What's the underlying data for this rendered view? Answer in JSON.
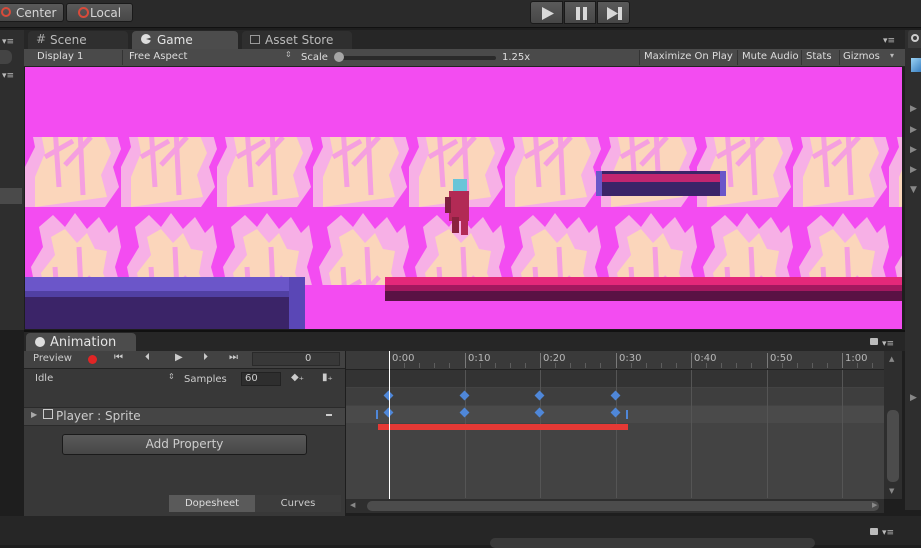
{
  "toolbar": {
    "pivot_label": "Center",
    "space_label": "Local",
    "play_icon": "play-icon",
    "pause_icon": "pause-icon",
    "step_icon": "step-icon"
  },
  "tabs": [
    {
      "label": "Scene",
      "icon": "grid-icon"
    },
    {
      "label": "Game",
      "icon": "pacman-icon"
    },
    {
      "label": "Asset Store",
      "icon": "store-icon"
    }
  ],
  "game_bar": {
    "display": "Display 1",
    "aspect": "Free Aspect",
    "scale_label": "Scale",
    "scale_value": "1.25x",
    "maximize": "Maximize On Play",
    "mute": "Mute Audio",
    "stats": "Stats",
    "gizmos": "Gizmos"
  },
  "animation": {
    "tab_label": "Animation",
    "preview_label": "Preview",
    "frame_value": "0",
    "clip_name": "Idle",
    "samples_label": "Samples",
    "samples_value": "60",
    "property_label": "Player : Sprite",
    "add_property": "Add Property",
    "dopesheet": "Dopesheet",
    "curves": "Curves",
    "ruler": [
      "0:00",
      "0:10",
      "0:20",
      "0:30",
      "0:40",
      "0:50",
      "1:00"
    ],
    "keyframe_times": [
      "0:00",
      "0:10",
      "0:20",
      "0:30"
    ]
  },
  "colors": {
    "game_bg": "#f34cf1",
    "keyframe": "#4f87d8",
    "highlight_bar": "#e53935",
    "playhead": "#ffffff"
  }
}
